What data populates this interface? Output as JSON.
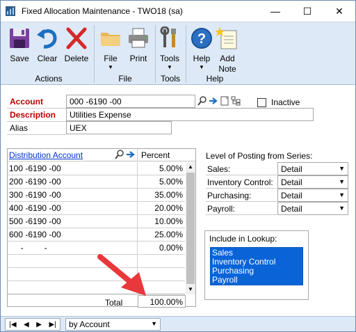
{
  "window": {
    "title": "Fixed Allocation Maintenance  -  TWO18 (sa)",
    "controls": {
      "minimize": "—",
      "maximize": "☐",
      "close": "✕"
    }
  },
  "ribbon": {
    "buttons": [
      {
        "label": "Save",
        "icon": "save-icon"
      },
      {
        "label": "Clear",
        "icon": "undo-icon"
      },
      {
        "label": "Delete",
        "icon": "delete-x-icon"
      },
      {
        "label": "File",
        "icon": "folder-icon"
      },
      {
        "label": "Print",
        "icon": "printer-icon"
      },
      {
        "label": "Tools",
        "icon": "tools-icon"
      },
      {
        "label": "Help",
        "icon": "help-icon"
      },
      {
        "label_line1": "Add",
        "label_line2": "Note",
        "icon": "add-note-icon"
      }
    ],
    "groups": [
      "Actions",
      "File",
      "Tools",
      "Help"
    ]
  },
  "form": {
    "account_label": "Account",
    "account_value": "000 -6190 -00",
    "description_label": "Description",
    "description_value": "Utilities Expense",
    "alias_label": "Alias",
    "alias_value": "UEX",
    "inactive_label": "Inactive",
    "inactive_checked": false
  },
  "distribution": {
    "col_account": "Distribution Account",
    "col_percent": "Percent",
    "rows": [
      {
        "account": "100 -6190 -00",
        "percent": "5.00%"
      },
      {
        "account": "200 -6190 -00",
        "percent": "5.00%"
      },
      {
        "account": "300 -6190 -00",
        "percent": "35.00%"
      },
      {
        "account": "400 -6190 -00",
        "percent": "20.00%"
      },
      {
        "account": "500 -6190 -00",
        "percent": "10.00%"
      },
      {
        "account": "600 -6190 -00",
        "percent": "25.00%"
      },
      {
        "account": "     -         -",
        "percent": "0.00%"
      }
    ],
    "total_label": "Total",
    "total_value": "100.00%"
  },
  "posting": {
    "title": "Level of Posting from Series:",
    "items": [
      {
        "label": "Sales:",
        "value": "Detail"
      },
      {
        "label": "Inventory Control:",
        "value": "Detail"
      },
      {
        "label": "Purchasing:",
        "value": "Detail"
      },
      {
        "label": "Payroll:",
        "value": "Detail"
      }
    ]
  },
  "lookup": {
    "title": "Include in Lookup:",
    "items": [
      "Sales",
      "Inventory Control",
      "Purchasing",
      "Payroll"
    ]
  },
  "statusbar": {
    "sort_value": "by Account"
  },
  "colors": {
    "required": "#c00000",
    "link": "#0033cc",
    "selection": "#0a64d8",
    "ribbon_bg": "#dde9f6",
    "annotation_arrow": "#e8383b"
  }
}
